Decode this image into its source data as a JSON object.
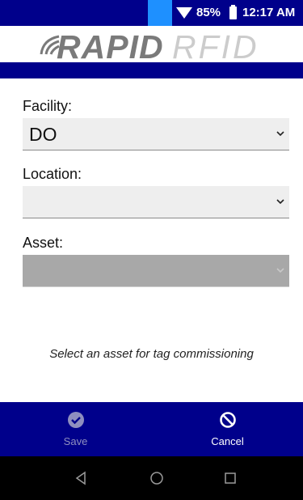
{
  "status_bar": {
    "battery_percent": "85%",
    "time": "12:17 AM",
    "icons": [
      "wifi-icon",
      "battery-icon"
    ]
  },
  "logo": {
    "part1": "RAPID",
    "part2": "RFID"
  },
  "form": {
    "facility": {
      "label": "Facility:",
      "value": "DO"
    },
    "location": {
      "label": "Location:",
      "value": ""
    },
    "asset": {
      "label": "Asset:",
      "value": "",
      "disabled": true
    }
  },
  "hint": "Select an asset for tag commissioning",
  "actions": {
    "save_label": "Save",
    "cancel_label": "Cancel"
  },
  "colors": {
    "primary": "#00008b",
    "status_accent": "#1e90ff",
    "field_bg": "#eeeeee",
    "disabled_field_bg": "#a8a8a8"
  }
}
